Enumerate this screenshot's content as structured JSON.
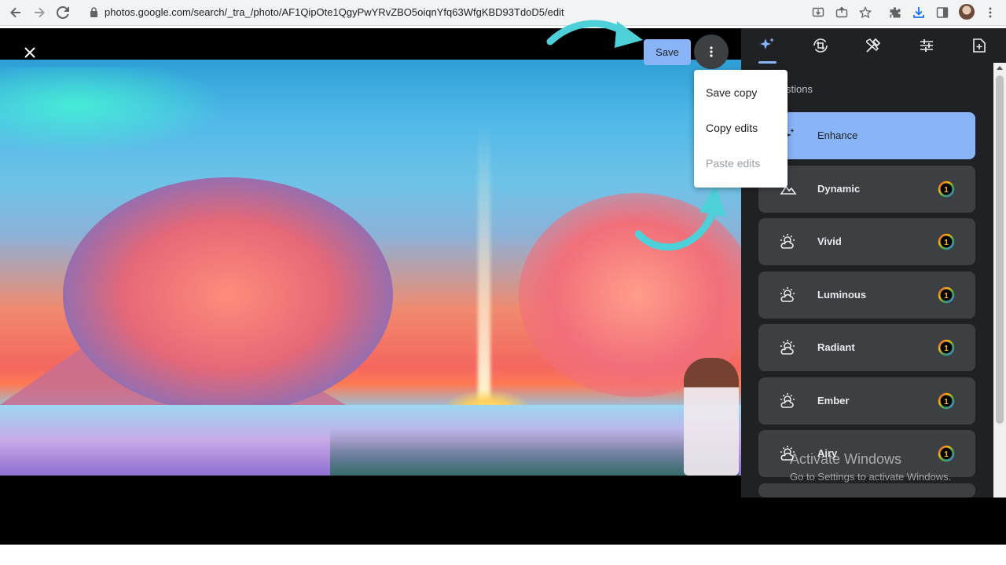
{
  "browser": {
    "url": "photos.google.com/search/_tra_/photo/AF1QipOte1QgyPwYRvZBO5oiqnYfq63WfgKBD93TdoD5/edit",
    "icons": [
      "back-icon",
      "forward-icon",
      "reload-icon",
      "lock-icon",
      "install-icon",
      "share-icon",
      "star-icon",
      "extensions-icon",
      "download-icon",
      "side-panel-icon",
      "profile-avatar",
      "menu-icon"
    ]
  },
  "editor": {
    "save_label": "Save",
    "menu": {
      "items": [
        {
          "label": "Save copy",
          "enabled": true
        },
        {
          "label": "Copy edits",
          "enabled": true
        },
        {
          "label": "Paste edits",
          "enabled": false
        }
      ]
    },
    "accent_color": "#8ab4f8",
    "annotation_color": "#4dd0d8"
  },
  "panel": {
    "tabs": [
      "suggestions-tab",
      "crop-tab",
      "tools-tab",
      "adjust-tab",
      "export-tab"
    ],
    "section_title": "Suggestions",
    "section_title_visible": "stions",
    "suggestions": [
      {
        "label": "Enhance",
        "icon": "sparkle-icon",
        "active": true,
        "badge": ""
      },
      {
        "label": "Dynamic",
        "icon": "landscape-icon",
        "active": false,
        "badge": "1"
      },
      {
        "label": "Vivid",
        "icon": "sun-cloud-icon",
        "active": false,
        "badge": "1"
      },
      {
        "label": "Luminous",
        "icon": "sun-cloud-icon",
        "active": false,
        "badge": "1"
      },
      {
        "label": "Radiant",
        "icon": "sun-cloud-icon",
        "active": false,
        "badge": "1"
      },
      {
        "label": "Ember",
        "icon": "sun-cloud-icon",
        "active": false,
        "badge": "1"
      },
      {
        "label": "Airy",
        "icon": "sun-cloud-icon",
        "active": false,
        "badge": "1"
      }
    ]
  },
  "watermark": {
    "title": "Activate Windows",
    "subtitle": "Go to Settings to activate Windows."
  }
}
